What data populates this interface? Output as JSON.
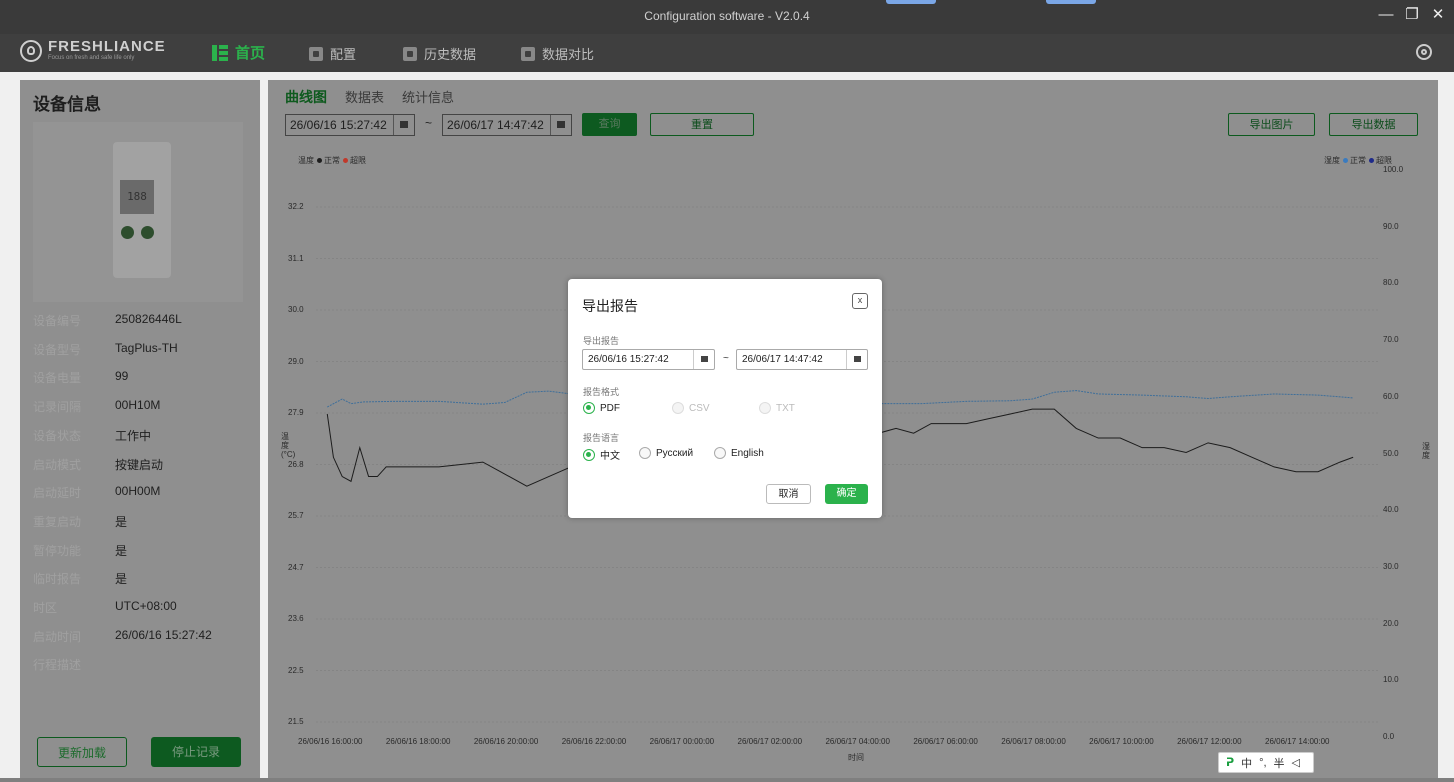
{
  "window": {
    "title": "Configuration software - V2.0.4"
  },
  "nav": {
    "brand": "FRESHLIANCE",
    "tagline": "Focus on fresh and safe life only",
    "items": [
      {
        "label": "首页",
        "active": true
      },
      {
        "label": "配置",
        "active": false
      },
      {
        "label": "历史数据",
        "active": false
      },
      {
        "label": "数据对比",
        "active": false
      }
    ]
  },
  "device": {
    "heading": "设备信息",
    "screen_text": "188",
    "fields": [
      {
        "key": "设备编号",
        "value": "250826446L"
      },
      {
        "key": "设备型号",
        "value": "TagPlus-TH"
      },
      {
        "key": "设备电量",
        "value": "99"
      },
      {
        "key": "记录间隔",
        "value": "00H10M"
      },
      {
        "key": "设备状态",
        "value": "工作中"
      },
      {
        "key": "启动模式",
        "value": "按键启动"
      },
      {
        "key": "启动延时",
        "value": "00H00M"
      },
      {
        "key": "重复启动",
        "value": "是"
      },
      {
        "key": "暂停功能",
        "value": "是"
      },
      {
        "key": "临时报告",
        "value": "是"
      },
      {
        "key": "时区",
        "value": "UTC+08:00"
      },
      {
        "key": "启动时间",
        "value": "26/06/16 15:27:42"
      },
      {
        "key": "行程描述",
        "value": ""
      }
    ],
    "reload_label": "更新加载",
    "stop_label": "停止记录"
  },
  "main": {
    "tabs": [
      "曲线图",
      "数据表",
      "统计信息"
    ],
    "start": "26/06/16 15:27:42",
    "end": "26/06/17 14:47:42",
    "tilde": "~",
    "query_label": "查询",
    "reset_label": "重置",
    "export_image_label": "导出图片",
    "export_data_label": "导出数据"
  },
  "chart_data": {
    "type": "line",
    "legend_left": {
      "name": "温度",
      "normal": "正常",
      "over": "超限",
      "normal_color": "#1e1e1e",
      "over_color": "#c0392b"
    },
    "legend_right": {
      "name": "湿度",
      "normal": "正常",
      "over": "超限",
      "normal_color": "#3a7bbf",
      "over_color": "#1e2a8a"
    },
    "ylabel_left": "温度(°C)",
    "ylabel_right": "湿度",
    "xlabel": "时间",
    "y_left_ticks": [
      "32.2",
      "31.1",
      "30.0",
      "29.0",
      "27.9",
      "26.8",
      "25.7",
      "24.7",
      "23.6",
      "22.5",
      "21.5"
    ],
    "y_right_ticks": [
      "100.0",
      "90.0",
      "80.0",
      "70.0",
      "60.0",
      "50.0",
      "40.0",
      "30.0",
      "20.0",
      "10.0",
      "0.0"
    ],
    "x_ticks": [
      "26/06/16 16:00:00",
      "26/06/16 18:00:00",
      "26/06/16 20:00:00",
      "26/06/16 22:00:00",
      "26/06/17 00:00:00",
      "26/06/17 02:00:00",
      "26/06/17 04:00:00",
      "26/06/17 06:00:00",
      "26/06/17 08:00:00",
      "26/06/17 10:00:00",
      "26/06/17 12:00:00",
      "26/06/17 14:00:00"
    ],
    "y_left_range": [
      21.5,
      32.2
    ],
    "y_right_range": [
      0,
      100
    ],
    "series": [
      {
        "name": "温度",
        "color": "#1e1e1e",
        "axis": "left",
        "x": [
          15.46,
          15.6,
          15.8,
          16.0,
          16.2,
          16.4,
          16.6,
          16.8,
          17.0,
          18.0,
          19.0,
          19.4,
          20.0,
          20.5,
          21.0,
          22.0,
          23.0,
          24.0,
          26.0,
          27.0,
          28.0,
          28.4,
          28.8,
          29.2,
          30.0,
          30.5,
          31.0,
          31.5,
          32.0,
          32.5,
          33.0,
          33.5,
          34.0,
          34.5,
          35.0,
          35.5,
          36.0,
          36.5,
          37.0,
          37.5,
          38.0,
          38.5,
          38.8
        ],
        "y": [
          27.9,
          27.0,
          26.6,
          26.5,
          27.2,
          26.6,
          26.6,
          26.8,
          26.8,
          26.8,
          26.9,
          26.7,
          26.4,
          26.6,
          26.8,
          27.2,
          27.5,
          27.5,
          27.5,
          27.5,
          27.5,
          27.6,
          27.5,
          27.7,
          27.7,
          27.8,
          27.9,
          28.0,
          28.0,
          27.6,
          27.4,
          27.4,
          27.2,
          27.2,
          27.1,
          27.3,
          27.2,
          27.0,
          26.8,
          26.7,
          26.7,
          26.9,
          27.0
        ]
      },
      {
        "name": "湿度",
        "color": "#3a7bbf",
        "axis": "right",
        "x": [
          15.46,
          15.8,
          16.0,
          16.3,
          17.0,
          18.0,
          19.0,
          19.5,
          20.0,
          20.5,
          21.0,
          21.5,
          22.0,
          22.5,
          26.0,
          29.0,
          30.0,
          31.0,
          31.5,
          32.0,
          32.5,
          33.0,
          34.0,
          35.0,
          35.5,
          36.0,
          37.0,
          38.0,
          38.8
        ],
        "y": [
          58.2,
          59.6,
          58.8,
          59.1,
          59.2,
          59.2,
          58.7,
          59.0,
          60.8,
          61.0,
          60.5,
          60.0,
          58.9,
          58.8,
          58.8,
          58.8,
          59.2,
          59.3,
          59.6,
          60.8,
          61.1,
          60.5,
          60.3,
          60.0,
          59.7,
          60.0,
          60.5,
          60.3,
          59.8
        ]
      }
    ]
  },
  "dialog": {
    "title": "导出报告",
    "close": "x",
    "range_label": "导出报告",
    "start": "26/06/16 15:27:42",
    "end": "26/06/17 14:47:42",
    "tilde": "~",
    "format_label": "报告格式",
    "formats": [
      "PDF",
      "CSV",
      "TXT"
    ],
    "language_label": "报告语言",
    "languages": [
      "中文",
      "Русский",
      "English"
    ],
    "cancel_label": "取消",
    "ok_label": "确定"
  },
  "ime": {
    "p": "ᕈ",
    "lang": "中",
    "punct": "°,",
    "width": "半",
    "tool": "◁"
  }
}
